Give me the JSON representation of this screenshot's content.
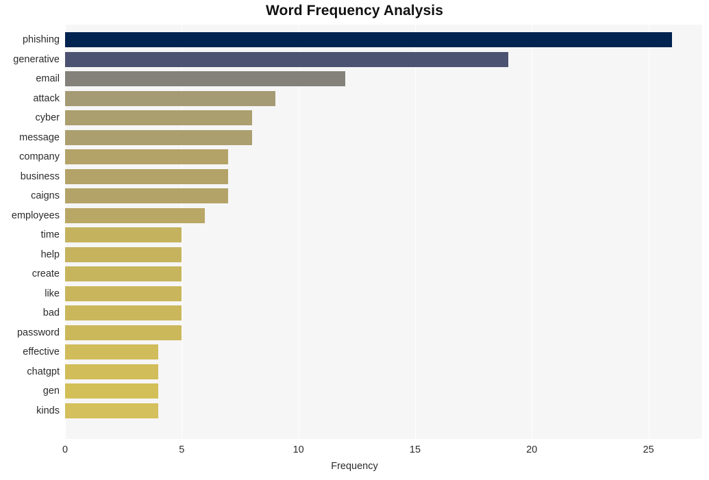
{
  "chart_data": {
    "type": "bar",
    "orientation": "horizontal",
    "title": "Word Frequency Analysis",
    "xlabel": "Frequency",
    "ylabel": "",
    "xlim": [
      0,
      27.3
    ],
    "xticks": [
      0,
      5,
      10,
      15,
      20,
      25
    ],
    "xtick_labels": [
      "0",
      "5",
      "10",
      "15",
      "20",
      "25"
    ],
    "grid": true,
    "grid_axis": "x",
    "legend": "none",
    "plot_background": "#f6f6f7",
    "categories": [
      "phishing",
      "generative",
      "email",
      "attack",
      "cyber",
      "message",
      "company",
      "business",
      "caigns",
      "employees",
      "time",
      "help",
      "create",
      "like",
      "bad",
      "password",
      "effective",
      "chatgpt",
      "gen",
      "kinds"
    ],
    "values": [
      26,
      19,
      12,
      9,
      8,
      8,
      7,
      7,
      7,
      6,
      5,
      5,
      5,
      5,
      5,
      5,
      4,
      4,
      4,
      4
    ],
    "bar_colors": [
      "#032350",
      "#4c5271",
      "#83817a",
      "#a49b74",
      "#ab9f6f",
      "#ab9f6f",
      "#b3a368",
      "#b3a368",
      "#b3a368",
      "#b9a766",
      "#c4b25f",
      "#c5b35e",
      "#c7b55d",
      "#c9b65c",
      "#cab75c",
      "#cbb85b",
      "#d0bc5a",
      "#d1bd59",
      "#d3bf58",
      "#d4c05c"
    ]
  }
}
